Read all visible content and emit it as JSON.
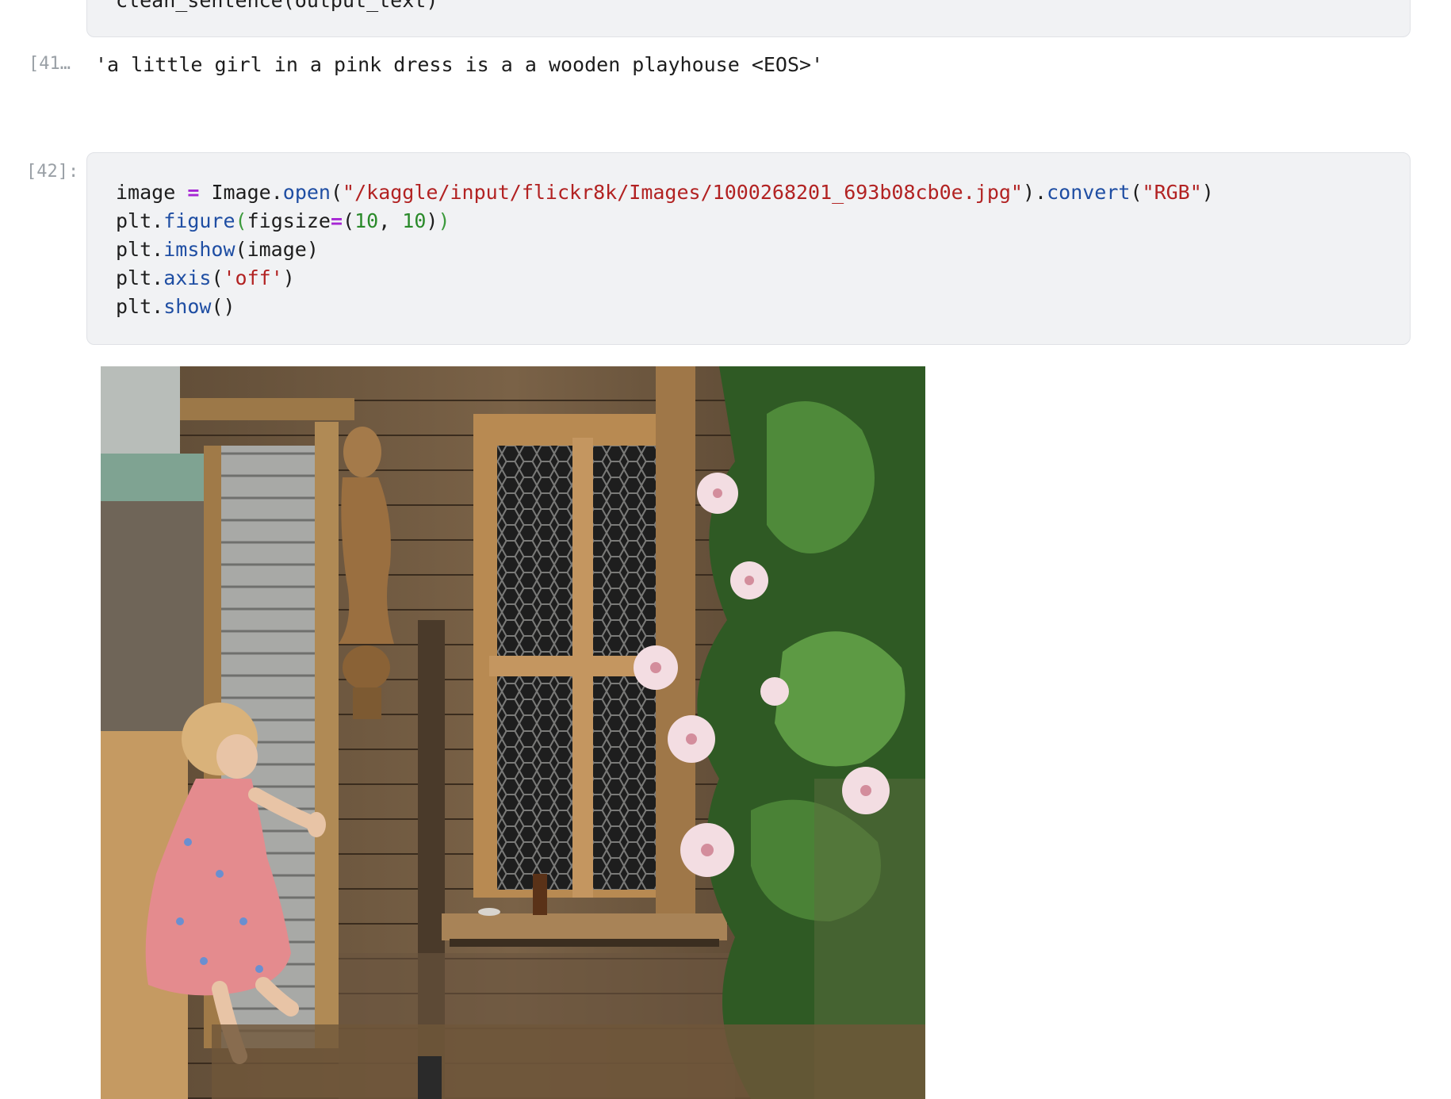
{
  "previous_cell": {
    "code_fragment": "clean_sentence(output_text)"
  },
  "cell_41": {
    "prompt": "[41…",
    "output": "'a little girl in a pink dress is a a wooden playhouse <EOS>'"
  },
  "cell_42": {
    "prompt": "[42]:",
    "code": {
      "l1_var": "image",
      "l1_eq": "=",
      "l1_obj": "Image.",
      "l1_fn_open": "open",
      "l1_p1": "(",
      "l1_path": "\"/kaggle/input/flickr8k/Images/1000268201_693b08cb0e.jpg\"",
      "l1_p2": ").",
      "l1_fn_convert": "convert",
      "l1_p3": "(",
      "l1_rgb": "\"RGB\"",
      "l1_p4": ")",
      "l2_obj": "plt.",
      "l2_fn": "figure",
      "l2_p1": "(",
      "l2_kw": "figsize",
      "l2_eq": "=",
      "l2_p2": "(",
      "l2_n1": "10",
      "l2_comma": ", ",
      "l2_n2": "10",
      "l2_p3": ")",
      "l2_p4": ")",
      "l3_obj": "plt.",
      "l3_fn": "imshow",
      "l3_args": "(image)",
      "l4_obj": "plt.",
      "l4_fn": "axis",
      "l4_p1": "(",
      "l4_str": "'off'",
      "l4_p2": ")",
      "l5_obj": "plt.",
      "l5_fn": "show",
      "l5_args": "()"
    }
  },
  "output_image": {
    "subject": "little girl in pink dress climbing into wooden playhouse with flowers"
  }
}
